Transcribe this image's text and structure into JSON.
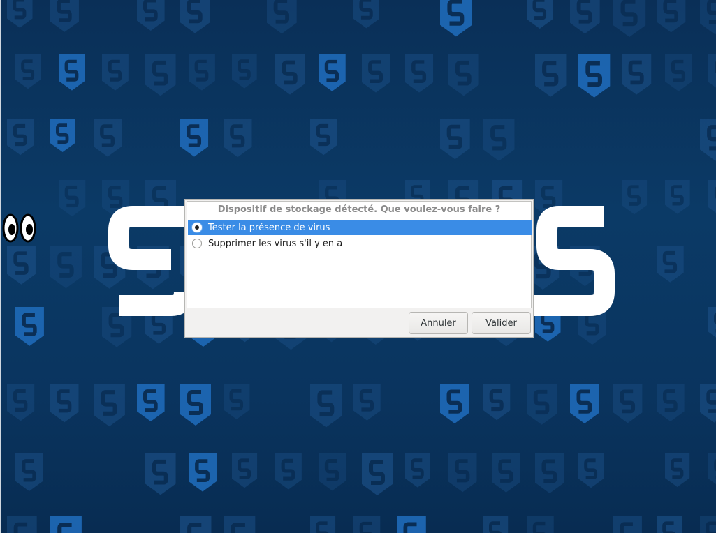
{
  "colors": {
    "background": "#0a3560",
    "shield": "#1b4f86",
    "shield_bright": "#1f6ab8",
    "logo": "#ffffff",
    "dialog_bg": "#f2f1f0",
    "selection": "#3a8ce6"
  },
  "desktop": {
    "background_icon": "shield-s-icon",
    "logo_letters_visible": [
      "S",
      "S"
    ],
    "mascot": "eyes-icon"
  },
  "dialog": {
    "title": "Dispositif de stockage détecté. Que voulez-vous faire ?",
    "options": [
      {
        "label": "Tester la présence de virus",
        "selected": true
      },
      {
        "label": "Supprimer les virus s'il y en a",
        "selected": false
      }
    ],
    "buttons": {
      "cancel": "Annuler",
      "ok": "Valider"
    }
  }
}
